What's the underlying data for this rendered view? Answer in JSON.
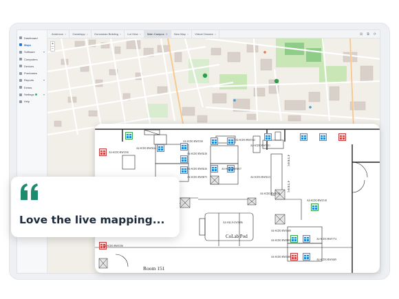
{
  "sidebar": {
    "items": [
      {
        "label": "Dashboard",
        "active": false,
        "caret": false,
        "dot": false
      },
      {
        "label": "Maps",
        "active": true,
        "caret": false,
        "dot": false
      },
      {
        "label": "Software",
        "active": false,
        "caret": true,
        "dot": false
      },
      {
        "label": "Computers",
        "active": false,
        "caret": false,
        "dot": false
      },
      {
        "label": "Devices",
        "active": false,
        "caret": false,
        "dot": false
      },
      {
        "label": "Purchases",
        "active": false,
        "caret": false,
        "dot": false
      },
      {
        "label": "Reports",
        "active": false,
        "caret": true,
        "dot": false
      },
      {
        "label": "Extras",
        "active": false,
        "caret": false,
        "dot": false
      },
      {
        "label": "Settings",
        "active": false,
        "caret": true,
        "dot": true
      },
      {
        "label": "Help",
        "active": false,
        "caret": false,
        "dot": false
      }
    ]
  },
  "tabs": [
    {
      "label": "Anderson",
      "active": false
    },
    {
      "label": "Camelopp",
      "active": false
    },
    {
      "label": "Gonzaman Building",
      "active": false
    },
    {
      "label": "Lot View",
      "active": false
    },
    {
      "label": "Main Campus",
      "active": true
    },
    {
      "label": "New Map",
      "active": false
    },
    {
      "label": "Virtual Classes",
      "active": false
    }
  ],
  "tab_tools": [
    "⊞",
    "⧉",
    "⟳"
  ],
  "map": {
    "zoom_in": "+",
    "zoom_out": "−",
    "colors": {
      "land": "#f2efe9",
      "road": "#ffffff",
      "building": "#d9d0c9",
      "park": "#c8e6b6",
      "green_dark": "#8fcc8a",
      "pin": "#2a9d4b"
    }
  },
  "floorplan": {
    "labels": [
      "A4-SCDC-RW1556",
      "A4-SCDC-RW1556",
      "A4-SCDC-RW1550",
      "A4-SCDC-RW1551",
      "A4-SCDC-RW0224",
      "A4-SCDC-RW0218",
      "A4-SCDC-RW0216",
      "A4-SCDC-RW0675",
      "A4-SCDC-RW1552",
      "A4-SCDC-RW0217",
      "A4-SCDC-RW1515",
      "A4-SCDC-RW0213",
      "A4-SCDC-RW1518",
      "A4-SALA-LW3006",
      "A4-SCDC-RW1600",
      "A4-SCDC-RW0083",
      "A4-SCDC-RW1774",
      "A4-SCDC-RW1600",
      "A4-SCDC-RW1609"
    ],
    "pod_label": "CoLab Pod",
    "room_label": "Room 151",
    "shelf_label": "SHELF"
  },
  "testimonial": {
    "quote": "Love the live mapping...",
    "accent_color": "#1e8a6e"
  }
}
